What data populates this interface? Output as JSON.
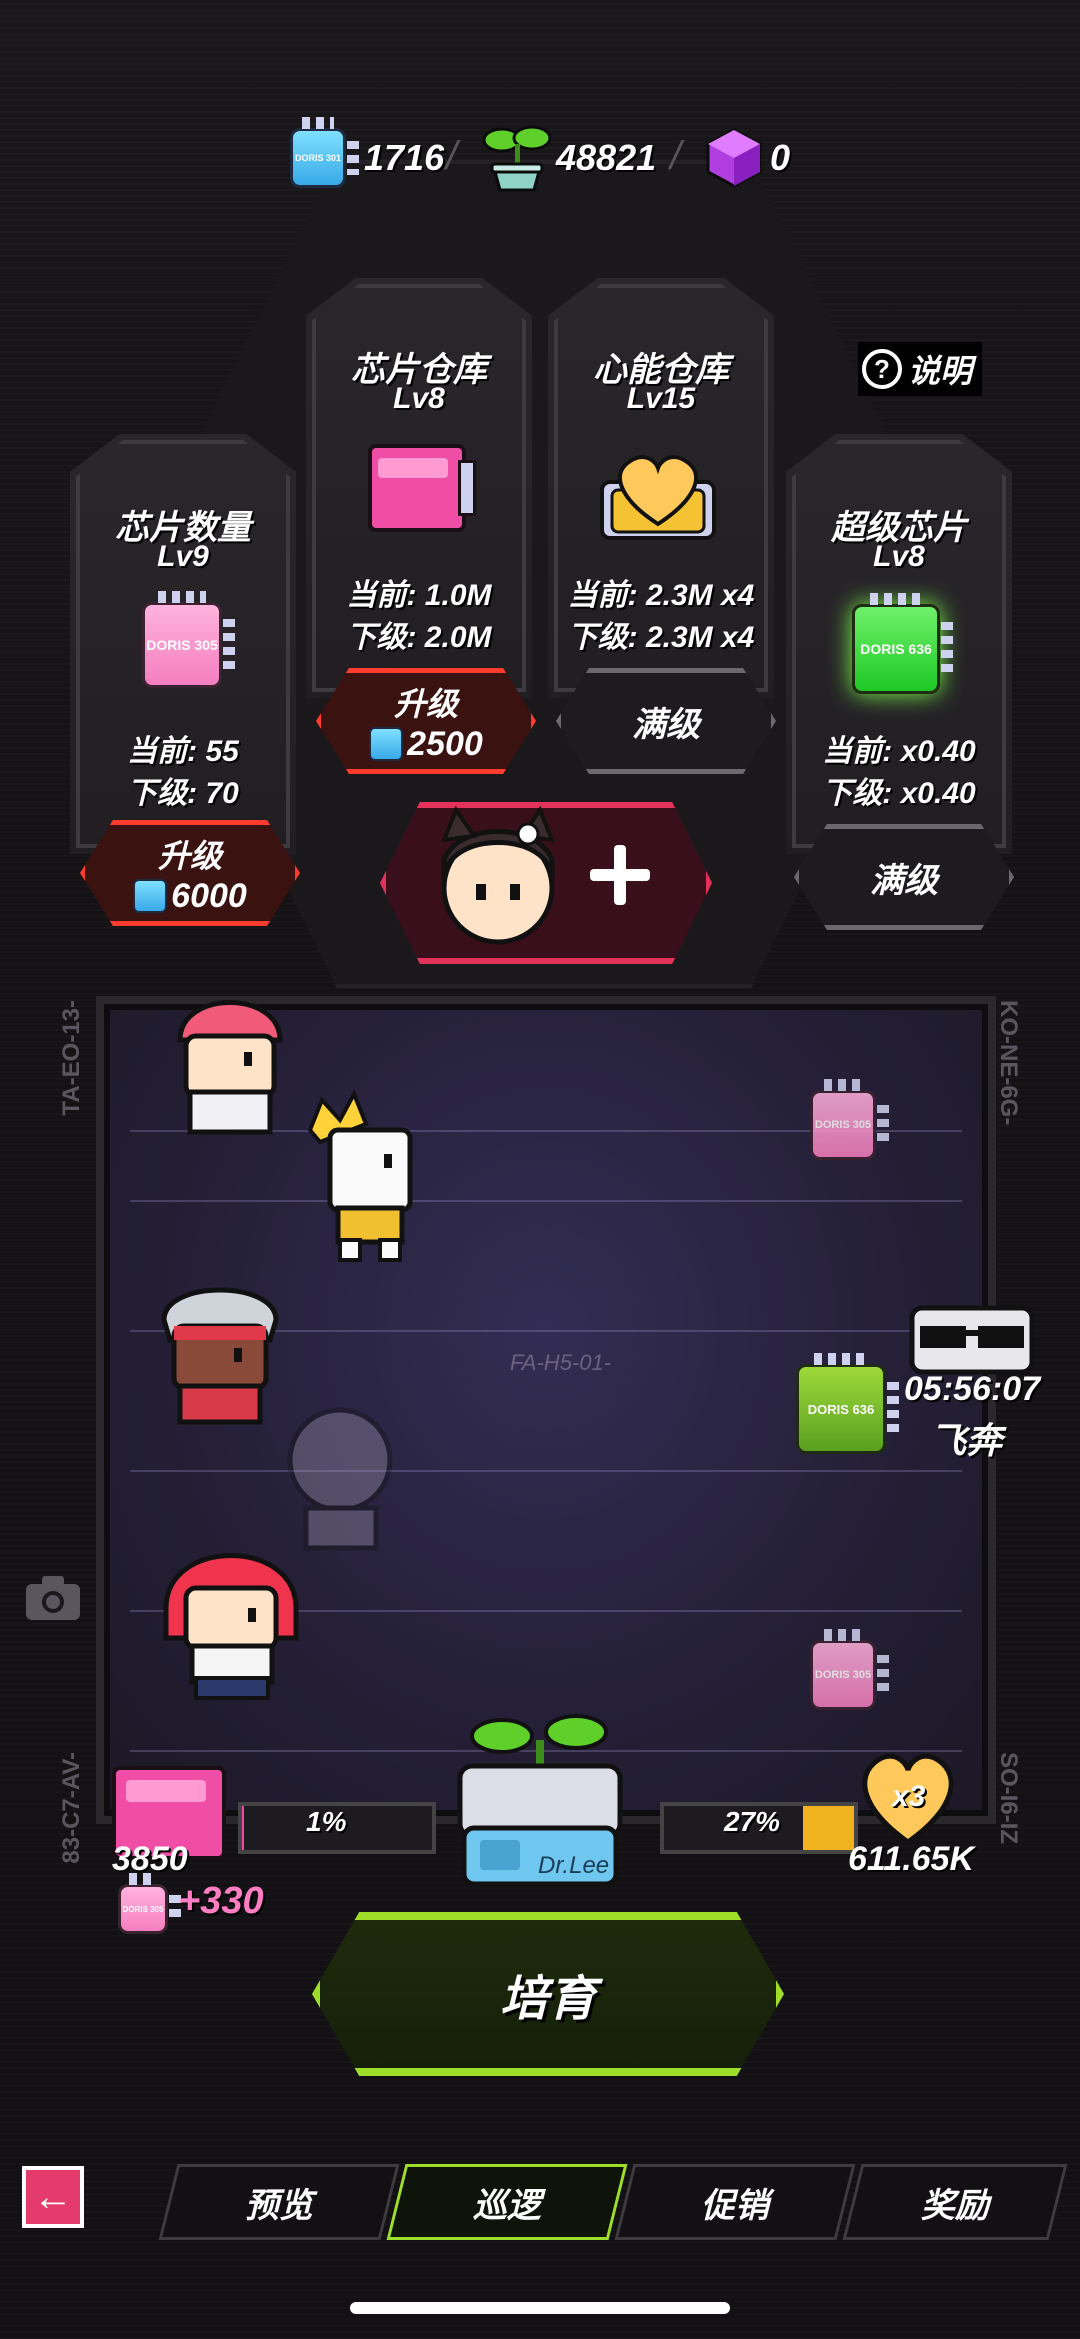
{
  "currencies": [
    {
      "icon": "blue-chip-icon",
      "chip_label": "DORIS 301",
      "value": "1716"
    },
    {
      "icon": "sprout-pot-icon",
      "value": "48821"
    },
    {
      "icon": "purple-cube-icon",
      "value": "0"
    }
  ],
  "help": {
    "label": "说明"
  },
  "panels": {
    "chip_count": {
      "title": "芯片数量",
      "level": "Lv9",
      "chip_label": "DORIS 305",
      "current": "当前: 55",
      "next": "下级: 70",
      "button_line1": "升级",
      "button_cost": "6000"
    },
    "chip_storage": {
      "title": "芯片仓库",
      "level": "Lv8",
      "current": "当前: 1.0M",
      "next": "下级: 2.0M",
      "button_line1": "升级",
      "button_cost": "2500"
    },
    "heart_storage": {
      "title": "心能仓库",
      "level": "Lv15",
      "current": "当前: 2.3M x4",
      "next": "下级: 2.3M x4",
      "button": "满级"
    },
    "super_chip": {
      "title": "超级芯片",
      "level": "Lv8",
      "chip_label": "DORIS 636",
      "current": "当前: x0.40",
      "next": "下级: x0.40",
      "button": "满级"
    }
  },
  "field": {
    "side_labels": {
      "left_top": "TA-EO-13-",
      "right_top": "KO-NE-6G-",
      "center": "FA-H5-01-",
      "left_bottom": "83-C7-AV-",
      "right_bottom": "SO-I6-IZ"
    },
    "chips": [
      {
        "label": "DORIS 305"
      },
      {
        "label": "DORIS 636"
      },
      {
        "label": "DORIS 305"
      }
    ],
    "timer": "05:56:07",
    "timer_label": "飞奔"
  },
  "production": {
    "left_value": "3850",
    "left_chip_label": "DORIS 305",
    "left_bonus": "+330",
    "left_percent": "1%",
    "left_fill": 0.01,
    "machine_label": "Dr.Lee",
    "right_percent": "27%",
    "right_fill": 0.27,
    "heart_multiplier": "x3",
    "heart_value": "611.65K"
  },
  "breed_button": "培育",
  "nav": {
    "back_icon": "back-arrow-icon",
    "tabs": [
      "预览",
      "巡逻",
      "促销",
      "奖励"
    ],
    "active": "巡逻"
  },
  "colors": {
    "upgrade_border": "#ff3b2e",
    "max_border": "#6b6870",
    "breed_border": "#9edd2a",
    "add_char_border": "#e2325a"
  }
}
